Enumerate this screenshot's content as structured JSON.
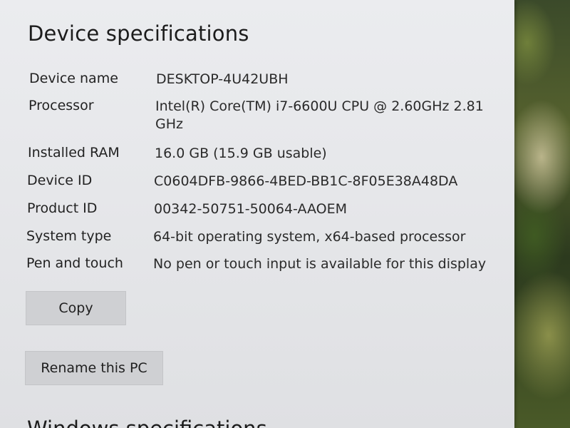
{
  "section": {
    "title": "Device specifications"
  },
  "specs": [
    {
      "label": "Device name",
      "value": "DESKTOP-4U42UBH"
    },
    {
      "label": "Processor",
      "value": "Intel(R) Core(TM) i7-6600U CPU @ 2.60GHz   2.81 GHz"
    },
    {
      "label": "Installed RAM",
      "value": "16.0 GB (15.9 GB usable)"
    },
    {
      "label": "Device ID",
      "value": "C0604DFB-9866-4BED-BB1C-8F05E38A48DA"
    },
    {
      "label": "Product ID",
      "value": "00342-50751-50064-AAOEM"
    },
    {
      "label": "System type",
      "value": "64-bit operating system, x64-based processor"
    },
    {
      "label": "Pen and touch",
      "value": "No pen or touch input is available for this display"
    }
  ],
  "buttons": {
    "copy_label": "Copy",
    "rename_label": "Rename this PC"
  },
  "next_section": {
    "title_partial": "Windows specifications"
  },
  "colors": {
    "panel_bg": "#e6e7ea",
    "button_bg": "#cfd0d3",
    "text": "#1f1f1f"
  }
}
